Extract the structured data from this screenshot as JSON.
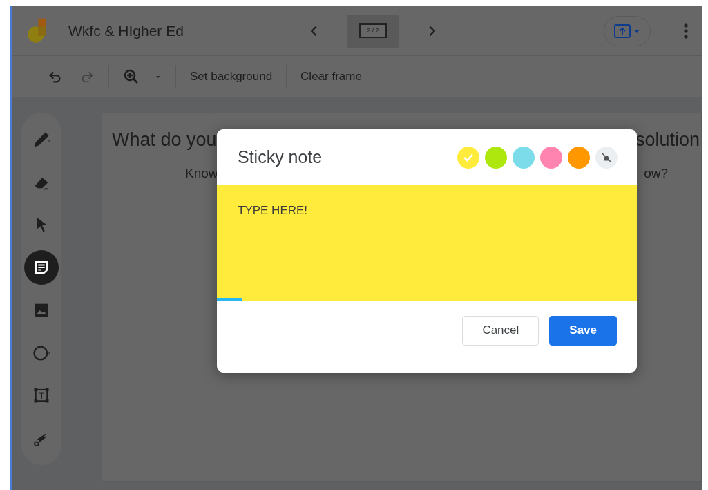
{
  "header": {
    "title": "Wkfc & HIgher Ed",
    "frame_counter": "2 / 2"
  },
  "toolbar": {
    "undo_disabled": false,
    "redo_disabled": true,
    "actions": [
      "Set background",
      "Clear frame"
    ]
  },
  "tools": [
    {
      "kind": "pen",
      "selected": false
    },
    {
      "kind": "eraser",
      "selected": false
    },
    {
      "kind": "select",
      "selected": false
    },
    {
      "kind": "sticky",
      "selected": true
    },
    {
      "kind": "image",
      "selected": false
    },
    {
      "kind": "circle",
      "selected": false
    },
    {
      "kind": "textbox",
      "selected": false
    },
    {
      "kind": "laser",
      "selected": false
    }
  ],
  "slide": {
    "line_1": [
      "What do you",
      "solution"
    ],
    "line_2": [
      "Know",
      "ow?"
    ]
  },
  "dialog": {
    "title": "Sticky note",
    "swatches": [
      {
        "kind": "swatch",
        "color": "#ffeb3b",
        "selected": true
      },
      {
        "kind": "swatch",
        "color": "#aee70e",
        "selected": false
      },
      {
        "kind": "swatch",
        "color": "#7ddcea",
        "selected": false
      },
      {
        "kind": "swatch",
        "color": "#ff85b0",
        "selected": false
      },
      {
        "kind": "swatch",
        "color": "#ff9800",
        "selected": false
      },
      {
        "kind": "none",
        "selected": false
      }
    ],
    "note_text": "TYPE HERE!",
    "level": 0.06,
    "buttons": [
      {
        "kind": "secondary",
        "label": "Cancel"
      },
      {
        "kind": "primary",
        "label": "Save"
      }
    ]
  }
}
